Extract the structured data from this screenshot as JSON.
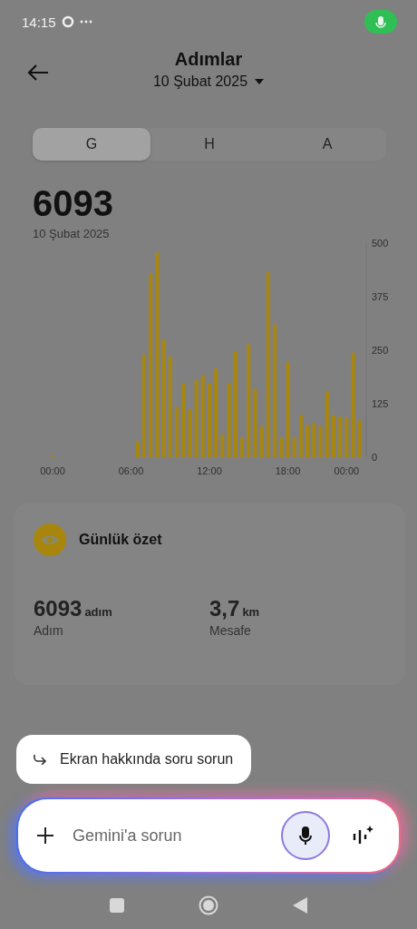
{
  "status_bar": {
    "time": "14:15"
  },
  "header": {
    "title": "Adımlar",
    "date": "10 Şubat 2025"
  },
  "tabs": [
    {
      "label": "G",
      "selected": true
    },
    {
      "label": "H",
      "selected": false
    },
    {
      "label": "A",
      "selected": false
    }
  ],
  "total": {
    "value": "6093",
    "date": "10 Şubat 2025"
  },
  "chart_data": {
    "type": "bar",
    "x": [
      0,
      6.5,
      7,
      7.5,
      8,
      8.5,
      9,
      9.5,
      10,
      10.5,
      11,
      11.5,
      12,
      12.5,
      13,
      13.5,
      14,
      14.5,
      15,
      15.5,
      16,
      16.5,
      17,
      17.5,
      18,
      18.5,
      19,
      19.5,
      20,
      20.5,
      21,
      21.5,
      22,
      22.5,
      23,
      23.5
    ],
    "xlim": [
      0,
      24
    ],
    "series": [
      {
        "color": "#a8860e",
        "values": [
          3,
          37,
          240,
          430,
          478,
          275,
          235,
          118,
          173,
          112,
          180,
          192,
          172,
          207,
          53,
          174,
          247,
          46,
          264,
          160,
          72,
          432,
          310,
          46,
          222,
          47,
          99,
          75,
          80,
          72,
          155,
          98,
          95,
          93,
          244,
          86
        ]
      }
    ],
    "ylim": [
      0,
      500
    ],
    "yticks": [
      0,
      125,
      250,
      375,
      500
    ],
    "xticks": [
      {
        "value": 0,
        "label": "00:00"
      },
      {
        "value": 6,
        "label": "06:00"
      },
      {
        "value": 12,
        "label": "12:00"
      },
      {
        "value": 18,
        "label": "18:00"
      },
      {
        "value": 22.5,
        "label": "00:00"
      }
    ]
  },
  "summary": {
    "title": "Günlük özet",
    "stats": [
      {
        "value": "6093",
        "unit": "adım",
        "label": "Adım"
      },
      {
        "value": "3,7",
        "unit": "km",
        "label": "Mesafe"
      }
    ]
  },
  "assistant": {
    "suggestion": "Ekran hakkında soru sorun",
    "placeholder": "Gemini'a sorun"
  }
}
